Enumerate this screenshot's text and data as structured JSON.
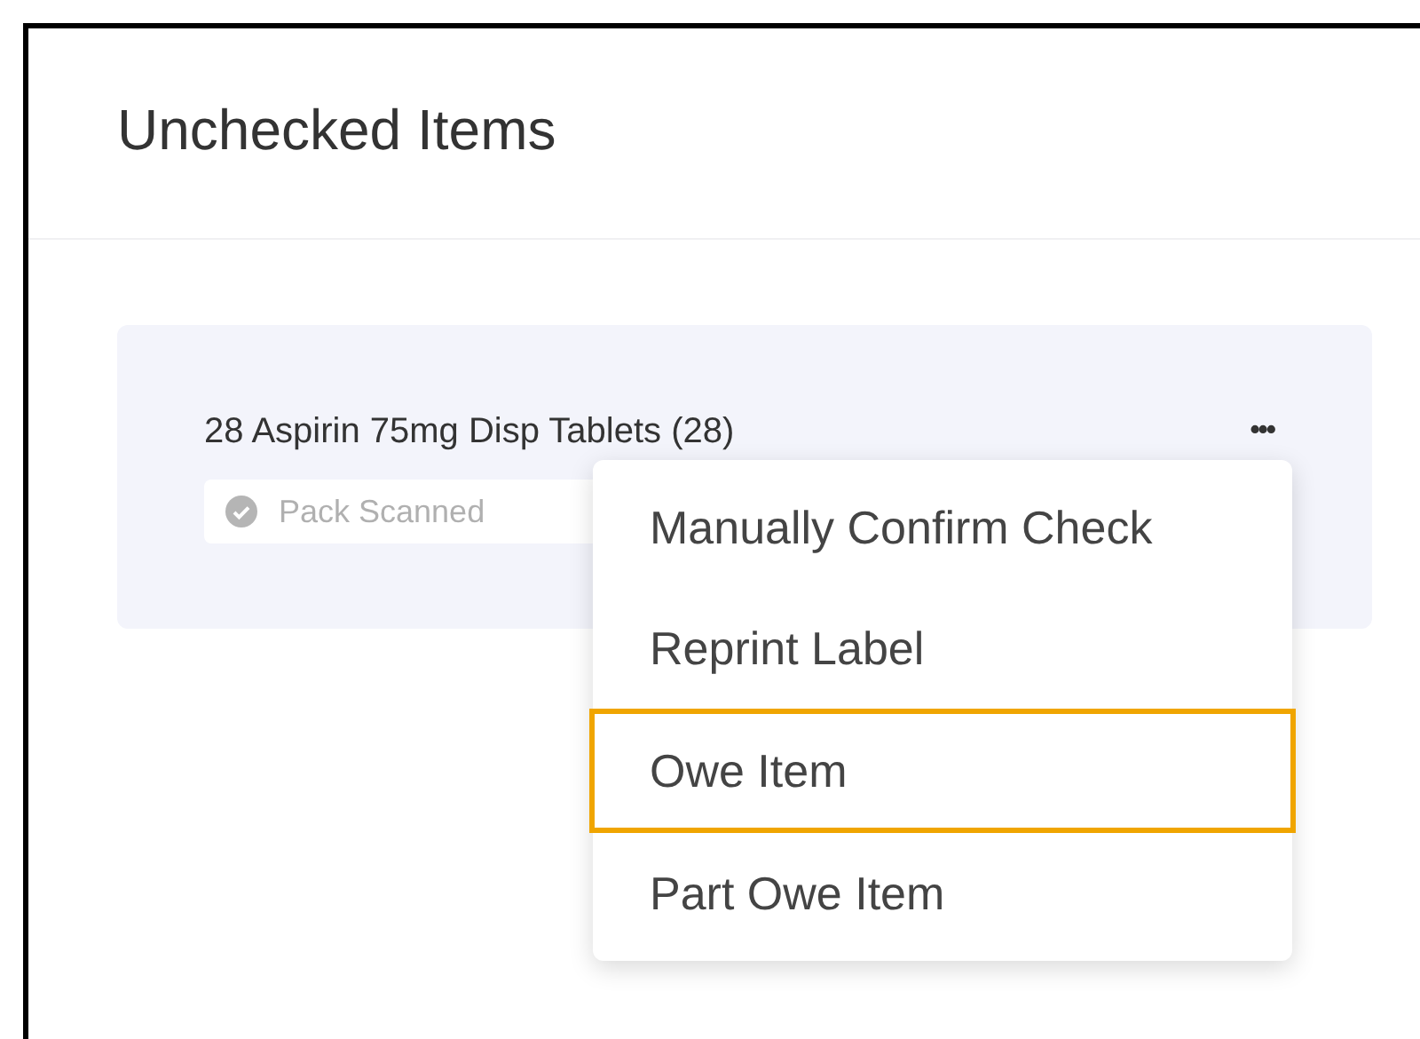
{
  "page": {
    "title": "Unchecked Items"
  },
  "item": {
    "name": "28 Aspirin 75mg Disp Tablets (28)",
    "status": "Pack Scanned",
    "more": "•••"
  },
  "menu": [
    {
      "label": "Manually Confirm Check",
      "selected": false
    },
    {
      "label": "Reprint Label",
      "selected": false
    },
    {
      "label": "Owe Item",
      "selected": true
    },
    {
      "label": "Part Owe Item",
      "selected": false
    }
  ]
}
